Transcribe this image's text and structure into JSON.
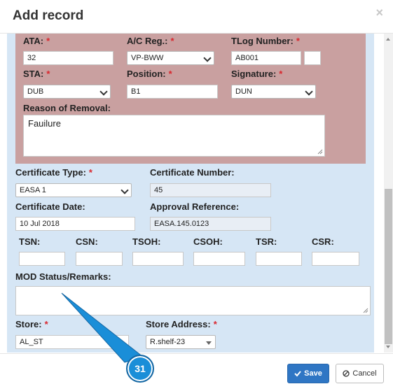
{
  "dialog": {
    "title": "Add record",
    "close_glyph": "×"
  },
  "fields": {
    "ata": {
      "label": "ATA:",
      "required": "*",
      "value": "32"
    },
    "ac_reg": {
      "label": "A/C Reg.:",
      "required": "*",
      "value": "VP-BWW"
    },
    "tlog": {
      "label": "TLog Number:",
      "required": "*",
      "value": "AB001",
      "value2": ""
    },
    "sta": {
      "label": "STA:",
      "required": "*",
      "value": "DUB"
    },
    "position": {
      "label": "Position:",
      "required": "*",
      "value": "B1"
    },
    "signature": {
      "label": "Signature:",
      "required": "*",
      "value": "DUN"
    },
    "reason": {
      "label": "Reason of Removal:",
      "value": "Fauilure"
    },
    "cert_type": {
      "label": "Certificate Type:",
      "required": "*",
      "value": "EASA 1"
    },
    "cert_number": {
      "label": "Certificate Number:",
      "value": "45"
    },
    "cert_date": {
      "label": "Certificate Date:",
      "value": "10 Jul 2018"
    },
    "approval_ref": {
      "label": "Approval Reference:",
      "value": "EASA.145.0123"
    },
    "tsn": {
      "label": "TSN:",
      "value": ""
    },
    "csn": {
      "label": "CSN:",
      "value": ""
    },
    "tsoh": {
      "label": "TSOH:",
      "value": ""
    },
    "csoh": {
      "label": "CSOH:",
      "value": ""
    },
    "tsr": {
      "label": "TSR:",
      "value": ""
    },
    "csr": {
      "label": "CSR:",
      "value": ""
    },
    "mod_status": {
      "label": "MOD Status/Remarks:",
      "value": ""
    },
    "store": {
      "label": "Store:",
      "required": "*",
      "value": "AL_ST"
    },
    "store_address": {
      "label": "Store Address:",
      "required": "*",
      "value": "R.shelf-23"
    }
  },
  "buttons": {
    "save": "Save",
    "cancel": "Cancel",
    "save_icon": "check-icon",
    "cancel_icon": "ban-icon"
  },
  "annotation": {
    "step": "31"
  },
  "colors": {
    "red_panel": "#c9a0a0",
    "blue_panel": "#d6e6f5",
    "primary": "#2f76c4",
    "required": "#d9272e",
    "callout": "#1a8ed8"
  }
}
